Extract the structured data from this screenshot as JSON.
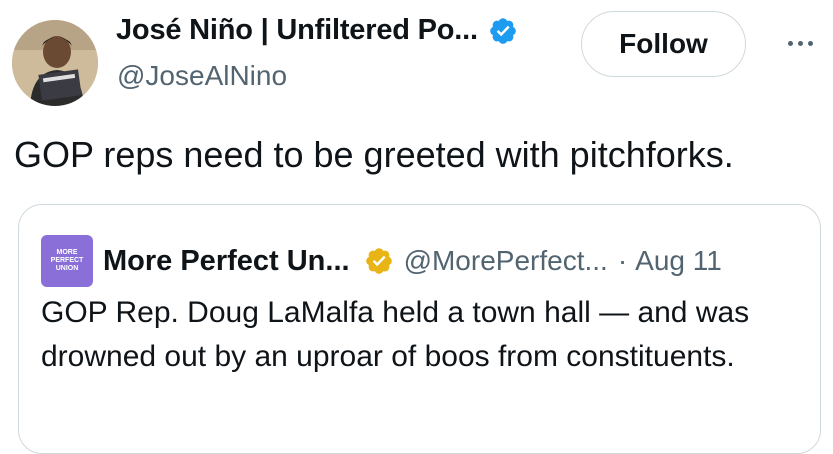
{
  "author": {
    "name": "José Niño | Unfiltered Po...",
    "handle": "@JoseAlNino",
    "verified_color": "#1d9bf0"
  },
  "actions": {
    "follow_label": "Follow",
    "more_icon": "more-horizontal-icon"
  },
  "tweet": {
    "text": "GOP reps need to be greeted with pitchforks."
  },
  "quoted": {
    "logo_lines": [
      "MORE",
      "PERFECT",
      "UNION"
    ],
    "name": "More Perfect Un...",
    "badge_color": "#e8b416",
    "handle": "@MorePerfect...",
    "separator": "·",
    "date": "Aug 11",
    "text": "GOP Rep. Doug LaMalfa held a town hall — and was drowned out by an uproar of boos from constituents."
  }
}
